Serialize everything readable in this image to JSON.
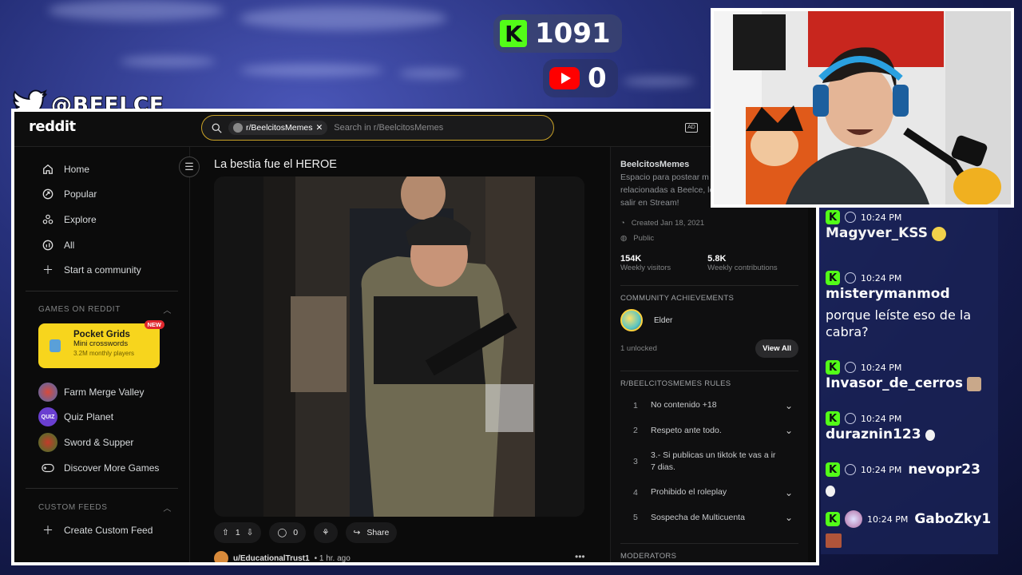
{
  "stream": {
    "kick_count": "1091",
    "youtube_count": "0",
    "twitter_handle": "@BEELCE_"
  },
  "reddit": {
    "logo": "reddit",
    "search": {
      "chip_label": "r/BeelcitosMemes",
      "placeholder": "Search in r/BeelcitosMemes"
    },
    "nav": [
      {
        "label": "Home",
        "icon": "home-icon"
      },
      {
        "label": "Popular",
        "icon": "popular-icon"
      },
      {
        "label": "Explore",
        "icon": "explore-icon"
      },
      {
        "label": "All",
        "icon": "all-icon"
      },
      {
        "label": "Start a community",
        "icon": "plus-icon"
      }
    ],
    "games_header": "GAMES ON REDDIT",
    "featured_game": {
      "title": "Pocket Grids",
      "subtitle": "Mini crosswords",
      "users": "3.2M monthly players",
      "badge": "NEW"
    },
    "games": [
      {
        "label": "Farm Merge Valley"
      },
      {
        "label": "Quiz Planet"
      },
      {
        "label": "Sword & Supper"
      },
      {
        "label": "Discover More Games"
      }
    ],
    "custom_feeds_header": "CUSTOM FEEDS",
    "create_feed": "Create Custom Feed",
    "post": {
      "title": "La bestia fue el HEROE",
      "votes": "1",
      "comments": "0",
      "share": "Share"
    },
    "next_post": {
      "author": "u/EducationalTrust1",
      "time": "• 1 hr. ago"
    },
    "subreddit": {
      "name": "BeelcitosMemes",
      "description": "Espacio para postear m relacionadas a Beelce, lo salir en Stream!",
      "created": "Created Jan 18, 2021",
      "visibility": "Public",
      "visitors": "154K",
      "visitors_label": "Weekly visitors",
      "contributions": "5.8K",
      "contributions_label": "Weekly contributions",
      "achievements_header": "COMMUNITY ACHIEVEMENTS",
      "achievement": "Elder",
      "unlocked": "1 unlocked",
      "view_all": "View All",
      "rules_header": "R/BEELCITOSMEMES RULES",
      "rules": [
        {
          "n": "1",
          "text": "No contenido +18"
        },
        {
          "n": "2",
          "text": "Respeto ante todo."
        },
        {
          "n": "3",
          "text": "3.- Si publicas un tiktok te vas a ir 7 dias."
        },
        {
          "n": "4",
          "text": "Prohibido el roleplay"
        },
        {
          "n": "5",
          "text": "Sospecha de Multicuenta"
        }
      ],
      "moderators_header": "MODERATORS"
    }
  },
  "chat": [
    {
      "time": "10:24 PM",
      "user": "Magyver_KSS",
      "text": ""
    },
    {
      "time": "10:24 PM",
      "user": "misterymanmod",
      "text": "porque leíste eso de la cabra?"
    },
    {
      "time": "10:24 PM",
      "user": "Invasor_de_cerros",
      "text": ""
    },
    {
      "time": "10:24 PM",
      "user": "duraznin123",
      "text": ""
    },
    {
      "time": "10:24 PM",
      "user": "nevopr23",
      "text": ""
    },
    {
      "time": "10:24 PM",
      "user": "GaboZky1",
      "text": ""
    }
  ]
}
